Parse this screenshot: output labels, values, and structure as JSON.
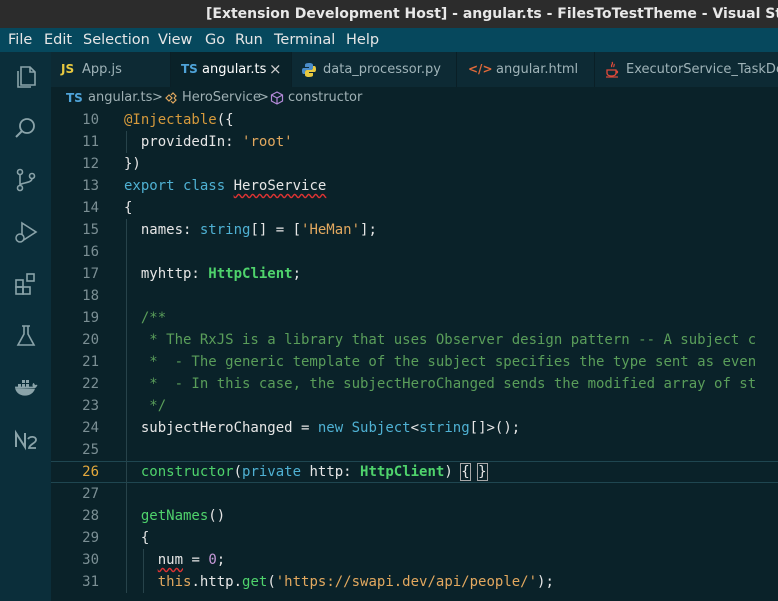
{
  "window": {
    "title": "[Extension Development Host] - angular.ts - FilesToTestTheme - Visual Studio Co"
  },
  "menu": [
    "File",
    "Edit",
    "Selection",
    "View",
    "Go",
    "Run",
    "Terminal",
    "Help"
  ],
  "activity_bar": [
    "explorer-icon",
    "search-icon",
    "source-control-icon",
    "run-debug-icon",
    "extensions-icon",
    "testing-icon",
    "docker-icon",
    "nx-console-icon"
  ],
  "tabs": [
    {
      "icon": "JS",
      "label": "App.js",
      "active": false
    },
    {
      "icon": "TS",
      "label": "angular.ts",
      "active": true,
      "close": "×"
    },
    {
      "icon": "python-icon",
      "label": "data_processor.py",
      "active": false
    },
    {
      "icon": "</>",
      "label": "angular.html",
      "active": false
    },
    {
      "icon": "java-icon",
      "label": "ExecutorService_TaskDep",
      "active": false
    }
  ],
  "breadcrumb": {
    "file_icon": "TS",
    "file": "angular.ts",
    "sep1": ">",
    "class": "HeroService",
    "sep2": ">",
    "member": "constructor"
  },
  "editor": {
    "current_line": 26,
    "lines": [
      {
        "n": "10",
        "tokens": [
          [
            "dec",
            "@Injectable"
          ],
          [
            "plain",
            "({"
          ]
        ]
      },
      {
        "n": "11",
        "tokens": [
          [
            "plain",
            "  providedIn: "
          ],
          [
            "str",
            "'root'"
          ]
        ]
      },
      {
        "n": "12",
        "tokens": [
          [
            "plain",
            "})"
          ]
        ]
      },
      {
        "n": "13",
        "tokens": [
          [
            "kw",
            "export"
          ],
          [
            "plain",
            " "
          ],
          [
            "kw",
            "class"
          ],
          [
            "plain",
            " "
          ],
          [
            "squig",
            "HeroService"
          ]
        ]
      },
      {
        "n": "14",
        "tokens": [
          [
            "plain",
            "{"
          ]
        ]
      },
      {
        "n": "15",
        "tokens": [
          [
            "plain",
            "  names: "
          ],
          [
            "type",
            "string"
          ],
          [
            "plain",
            "[] = ["
          ],
          [
            "str",
            "'HeMan'"
          ],
          [
            "plain",
            "];"
          ]
        ]
      },
      {
        "n": "16",
        "tokens": []
      },
      {
        "n": "17",
        "tokens": [
          [
            "plain",
            "  myhttp: "
          ],
          [
            "cls",
            "HttpClient"
          ],
          [
            "plain",
            ";"
          ]
        ]
      },
      {
        "n": "18",
        "tokens": []
      },
      {
        "n": "19",
        "tokens": [
          [
            "cmt",
            "  /**"
          ]
        ]
      },
      {
        "n": "20",
        "tokens": [
          [
            "cmt",
            "   * The RxJS is a library that uses Observer design pattern -- A subject c"
          ]
        ]
      },
      {
        "n": "21",
        "tokens": [
          [
            "cmt",
            "   *  - The generic template of the subject specifies the type sent as even"
          ]
        ]
      },
      {
        "n": "22",
        "tokens": [
          [
            "cmt",
            "   *  - In this case, the subjectHeroChanged sends the modified array of st"
          ]
        ]
      },
      {
        "n": "23",
        "tokens": [
          [
            "cmt",
            "   */"
          ]
        ]
      },
      {
        "n": "24",
        "tokens": [
          [
            "plain",
            "  subjectHeroChanged = "
          ],
          [
            "kw",
            "new"
          ],
          [
            "plain",
            " "
          ],
          [
            "type",
            "Subject"
          ],
          [
            "plain",
            "<"
          ],
          [
            "type",
            "string"
          ],
          [
            "plain",
            "[]>();"
          ]
        ]
      },
      {
        "n": "25",
        "tokens": []
      },
      {
        "n": "26",
        "tokens": [
          [
            "plain",
            "  "
          ],
          [
            "fn",
            "constructor"
          ],
          [
            "plain",
            "("
          ],
          [
            "kw",
            "private"
          ],
          [
            "plain",
            " http: "
          ],
          [
            "cls",
            "HttpClient"
          ],
          [
            "plain",
            ") "
          ],
          [
            "match",
            "{"
          ],
          [
            "plain",
            " "
          ],
          [
            "match",
            "}"
          ]
        ]
      },
      {
        "n": "27",
        "tokens": []
      },
      {
        "n": "28",
        "tokens": [
          [
            "plain",
            "  "
          ],
          [
            "fn",
            "getNames"
          ],
          [
            "plain",
            "()"
          ]
        ]
      },
      {
        "n": "29",
        "tokens": [
          [
            "plain",
            "  {"
          ]
        ]
      },
      {
        "n": "30",
        "tokens": [
          [
            "plain",
            "    "
          ],
          [
            "squig",
            "num"
          ],
          [
            "plain",
            " = "
          ],
          [
            "num",
            "0"
          ],
          [
            "plain",
            ";"
          ]
        ]
      },
      {
        "n": "31",
        "tokens": [
          [
            "plain",
            "    "
          ],
          [
            "this",
            "this"
          ],
          [
            "plain",
            ".http."
          ],
          [
            "fn",
            "get"
          ],
          [
            "plain",
            "("
          ],
          [
            "str",
            "'https://swapi.dev/api/people/'"
          ],
          [
            "plain",
            ");"
          ]
        ]
      }
    ]
  }
}
